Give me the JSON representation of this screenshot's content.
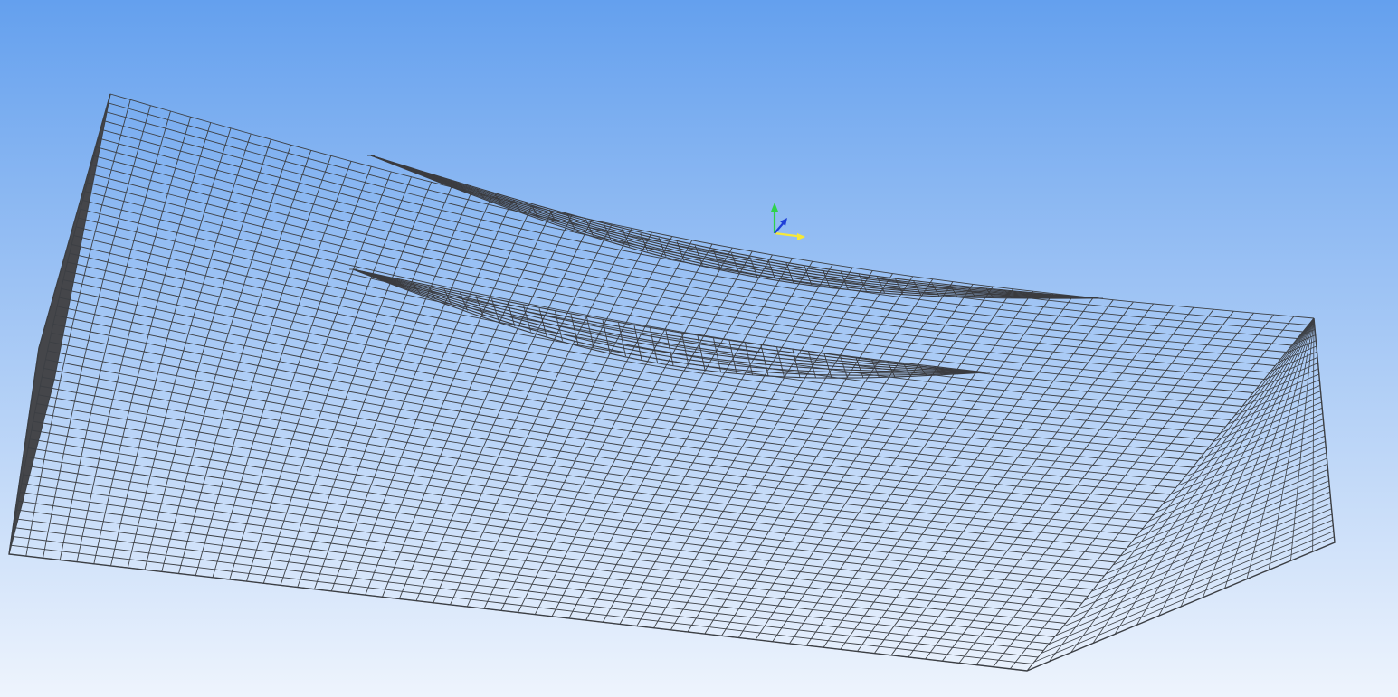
{
  "viewport": {
    "background_top": "#64a0ee",
    "background_bottom": "#eef4fd"
  },
  "mesh": {
    "line_color": "#3c3f44",
    "side_face_color": "#45464a",
    "cavity_color": "#3a3b3f"
  },
  "triad": {
    "x_axis_color": "#f5e83a",
    "y_axis_color": "#2fd24a",
    "z_axis_color": "#1f3fd8"
  }
}
